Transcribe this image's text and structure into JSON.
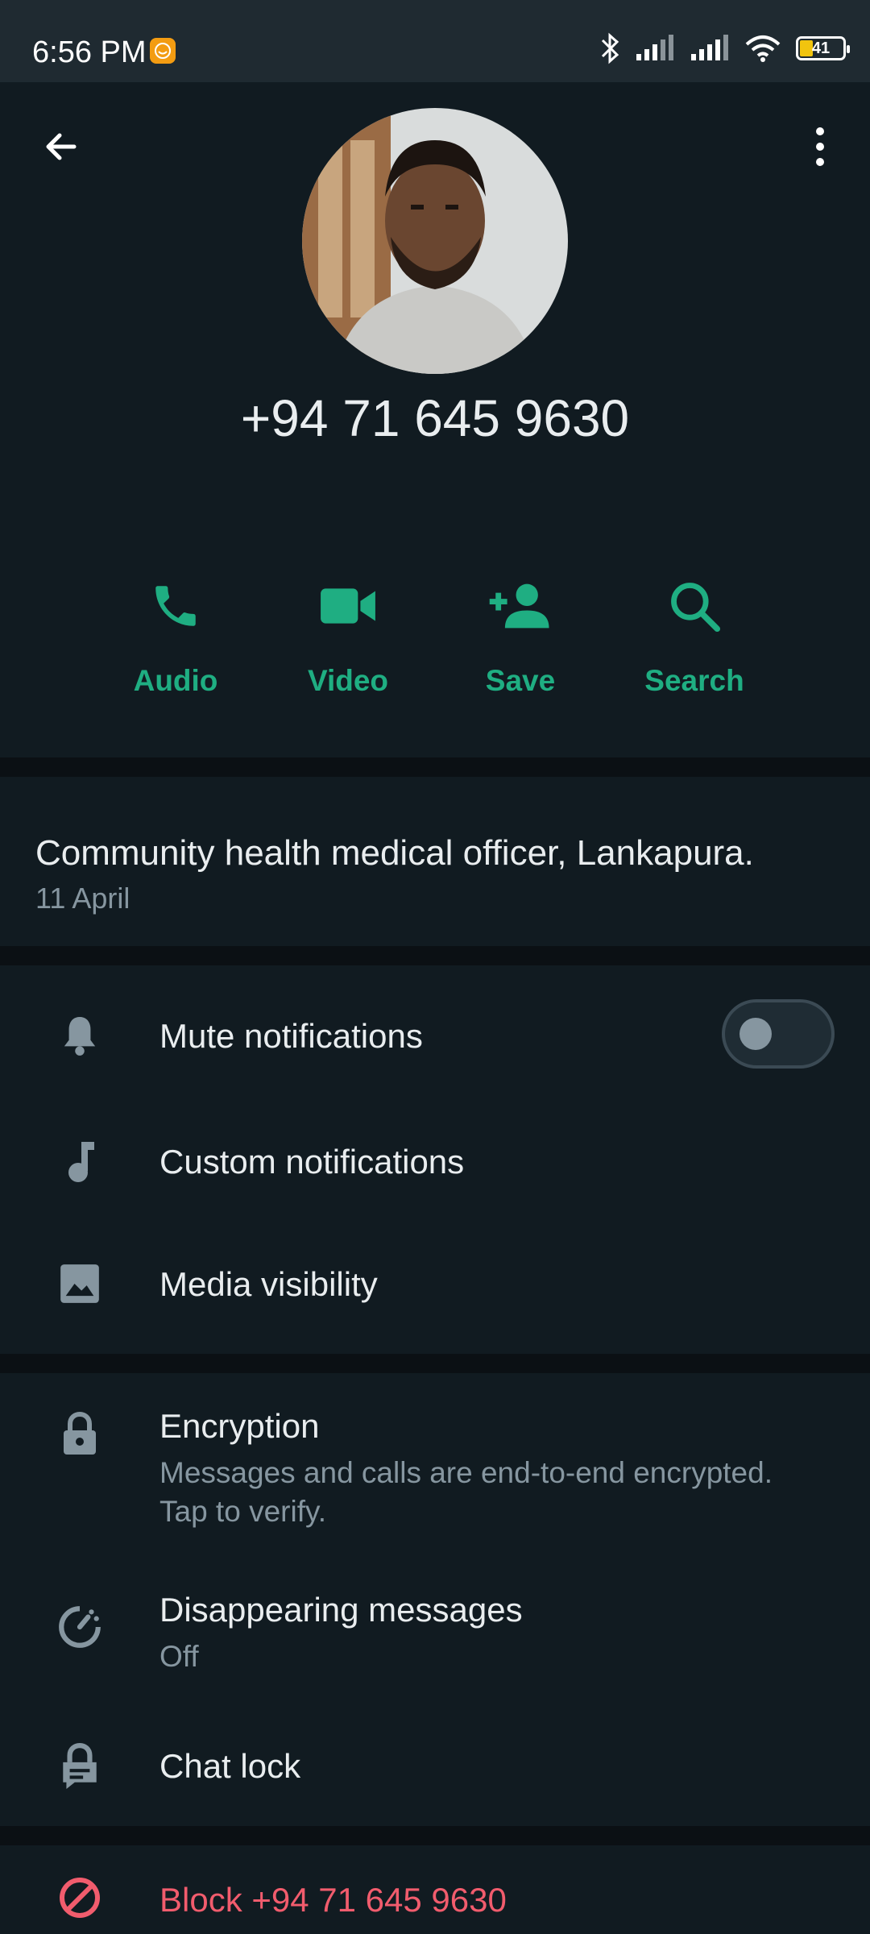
{
  "status_bar": {
    "time": "6:56 PM",
    "battery": "41"
  },
  "header": {
    "phone": "+94 71 645 9630"
  },
  "actions": [
    {
      "label": "Audio",
      "icon": "phone-icon"
    },
    {
      "label": "Video",
      "icon": "video-icon"
    },
    {
      "label": "Save",
      "icon": "add-person-icon"
    },
    {
      "label": "Search",
      "icon": "search-icon"
    }
  ],
  "about": {
    "text": "Community health medical officer, Lankapura.",
    "date": "11 April"
  },
  "settings": {
    "mute": {
      "label": "Mute notifications"
    },
    "custom": {
      "label": "Custom notifications"
    },
    "media": {
      "label": "Media visibility"
    },
    "encryption": {
      "label": "Encryption",
      "sub": "Messages and calls are end-to-end encrypted. Tap to verify."
    },
    "disappearing": {
      "label": "Disappearing messages",
      "sub": "Off"
    },
    "chat_lock": {
      "label": "Chat lock"
    }
  },
  "danger": {
    "block": "Block +94 71 645 9630"
  },
  "colors": {
    "accent": "#1fae82",
    "danger": "#f15c6d",
    "background": "#111b21"
  }
}
